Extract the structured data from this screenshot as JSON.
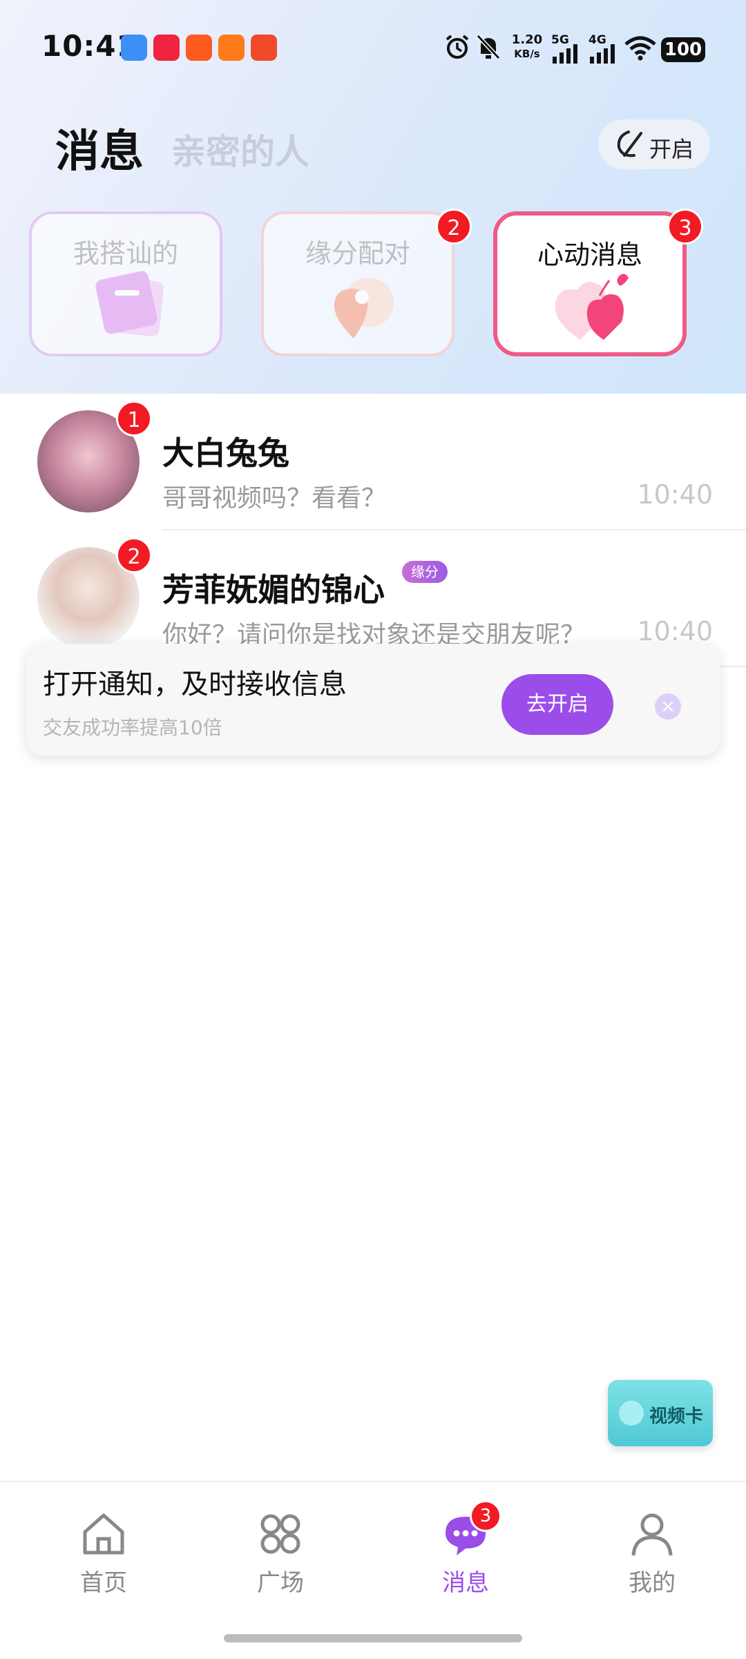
{
  "status_bar": {
    "time": "10:41",
    "net_speed_value": "1.20",
    "net_speed_unit": "KB/s",
    "signal1_label": "5G",
    "signal2_label": "4G",
    "battery": "100",
    "icons": [
      "alipay-icon",
      "xiaohongshu-icon",
      "taobao-icon",
      "kuaishou-icon",
      "app-icon",
      "alarm-icon",
      "mute-icon",
      "wifi-icon"
    ]
  },
  "header": {
    "tab_active": "消息",
    "tab_inactive": "亲密的人",
    "toggle_label": "开启"
  },
  "cards": [
    {
      "title": "我搭讪的",
      "badge": null
    },
    {
      "title": "缘分配对",
      "badge": "2"
    },
    {
      "title": "心动消息",
      "badge": "3"
    }
  ],
  "chats": [
    {
      "name": "大白兔兔",
      "message": "哥哥视频吗？看看？",
      "time": "10:40",
      "badge": "1",
      "tag": null
    },
    {
      "name": "芳菲妩媚的锦心",
      "message": "你好？请问你是找对象还是交朋友呢？",
      "time": "10:40",
      "badge": "2",
      "tag": "缘分"
    }
  ],
  "notify": {
    "title": "打开通知，及时接收信息",
    "subtitle": "交友成功率提高10倍",
    "button": "去开启",
    "close": "×"
  },
  "video_card": {
    "label": "视频卡"
  },
  "tabbar": {
    "items": [
      {
        "label": "首页"
      },
      {
        "label": "广场"
      },
      {
        "label": "消息",
        "badge": "3"
      },
      {
        "label": "我的"
      }
    ]
  },
  "colors": {
    "accent": "#9b4dea",
    "badge": "#f21b24",
    "heart_pink": "#f2467a"
  }
}
